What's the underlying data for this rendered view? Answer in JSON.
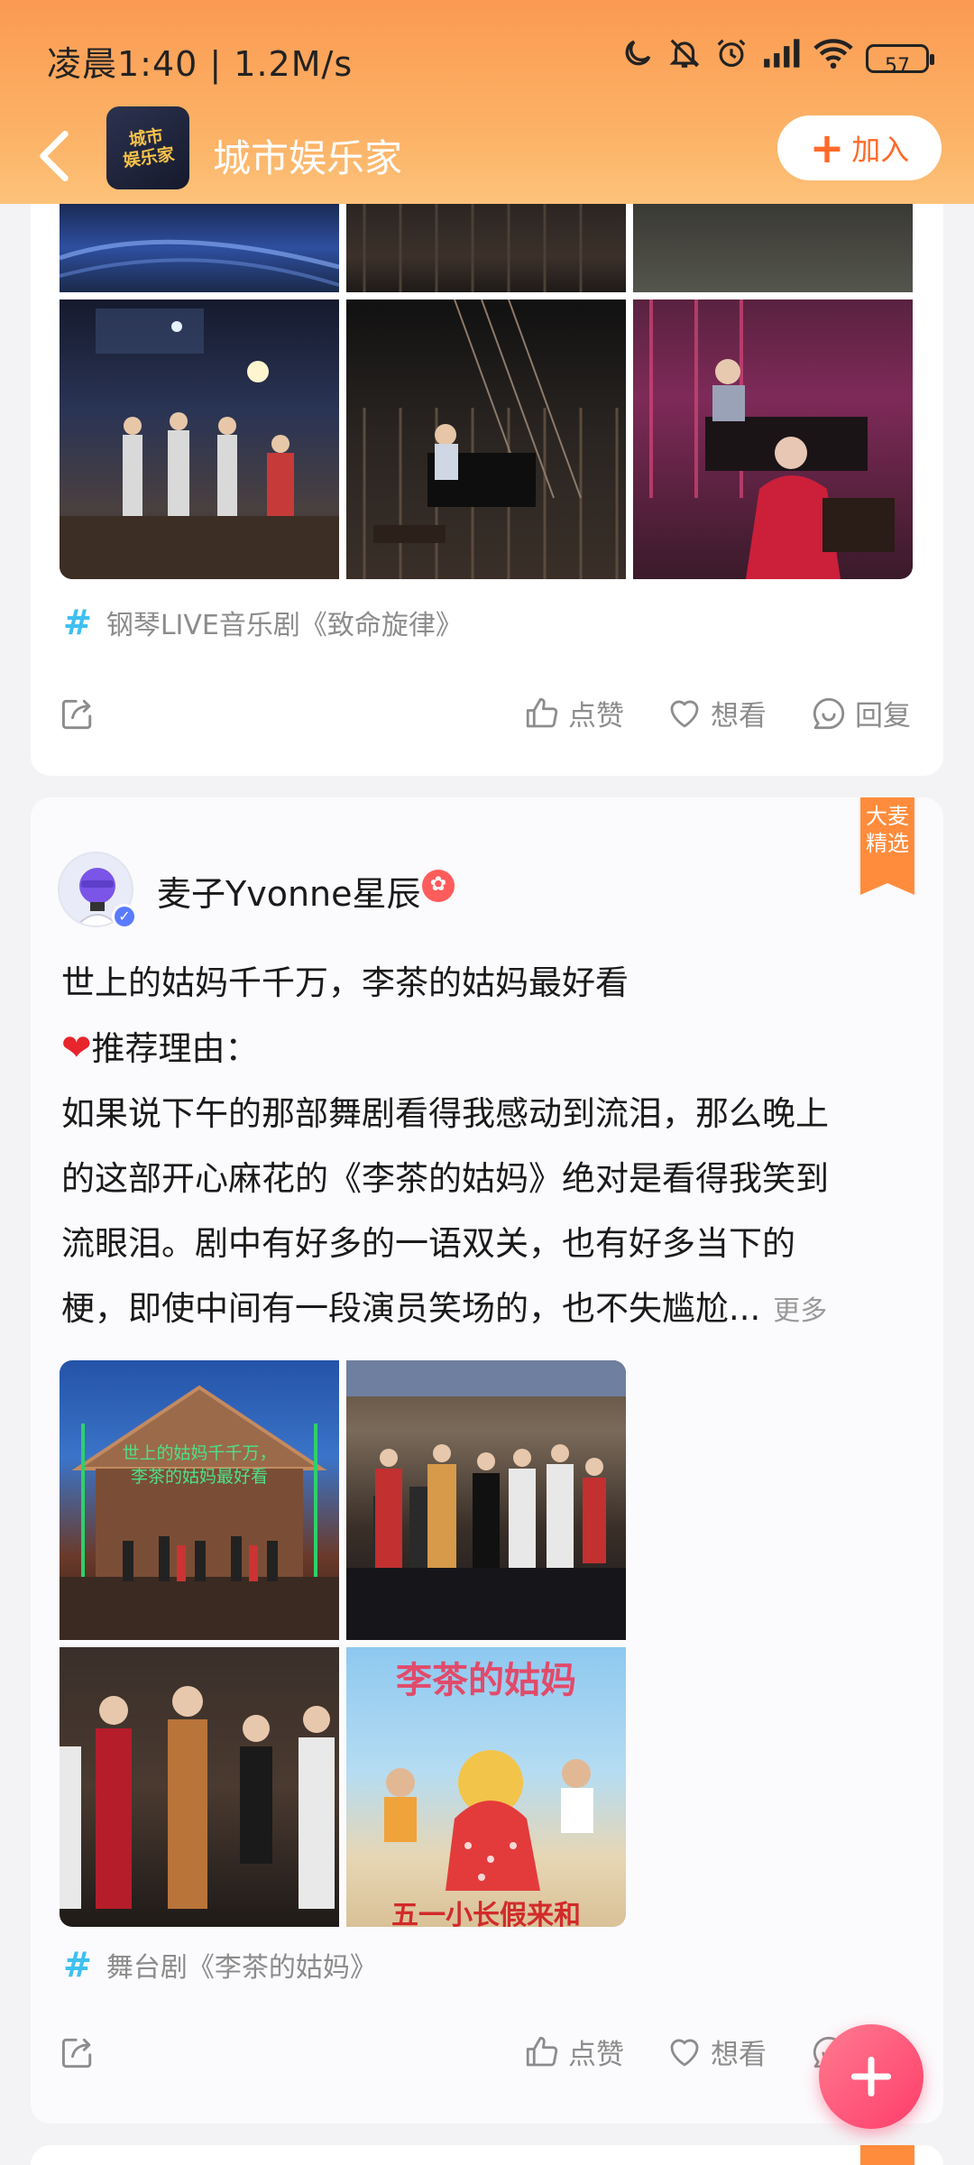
{
  "status_bar": {
    "time": "凌晨1:40 | 1.2M/s",
    "battery": "57"
  },
  "header": {
    "back_icon": "chevron-left-icon",
    "group_logo_text_line1": "城市",
    "group_logo_text_line2": "娱乐家",
    "title": "城市娱乐家",
    "join_label": "加入",
    "accent_color": "#ff6a2a"
  },
  "posts": [
    {
      "topic": "钢琴LIVE音乐剧《致命旋律》",
      "actions": {
        "like": "点赞",
        "want": "想看",
        "reply": "回复"
      }
    },
    {
      "username": "麦子Yvonne星辰",
      "ribbon_line1": "大麦",
      "ribbon_line2": "精选",
      "title_line": "世上的姑妈千千万，李茶的姑妈最好看",
      "reason_label": "推荐理由：",
      "body_lines": [
        "如果说下午的那部舞剧看得我感动到流泪，那么晚上",
        "的这部开心麻花的《李茶的姑妈》绝对是看得我笑到",
        "流眼泪。剧中有好多的一语双关，也有好多当下的",
        "梗，即使中间有一段演员笑场的，也不失尴尬..."
      ],
      "more_label": "更多",
      "photo1_caption_line1": "世上的姑妈千千万，",
      "photo1_caption_line2": "李茶的姑妈最好看",
      "poster_title": "李茶的姑妈",
      "poster_subtitle": "五一小长假来和",
      "topic": "舞台剧《李茶的姑妈》",
      "actions": {
        "like": "点赞",
        "want": "想看",
        "reply": "回复"
      }
    }
  ],
  "fab_icon": "plus-icon"
}
